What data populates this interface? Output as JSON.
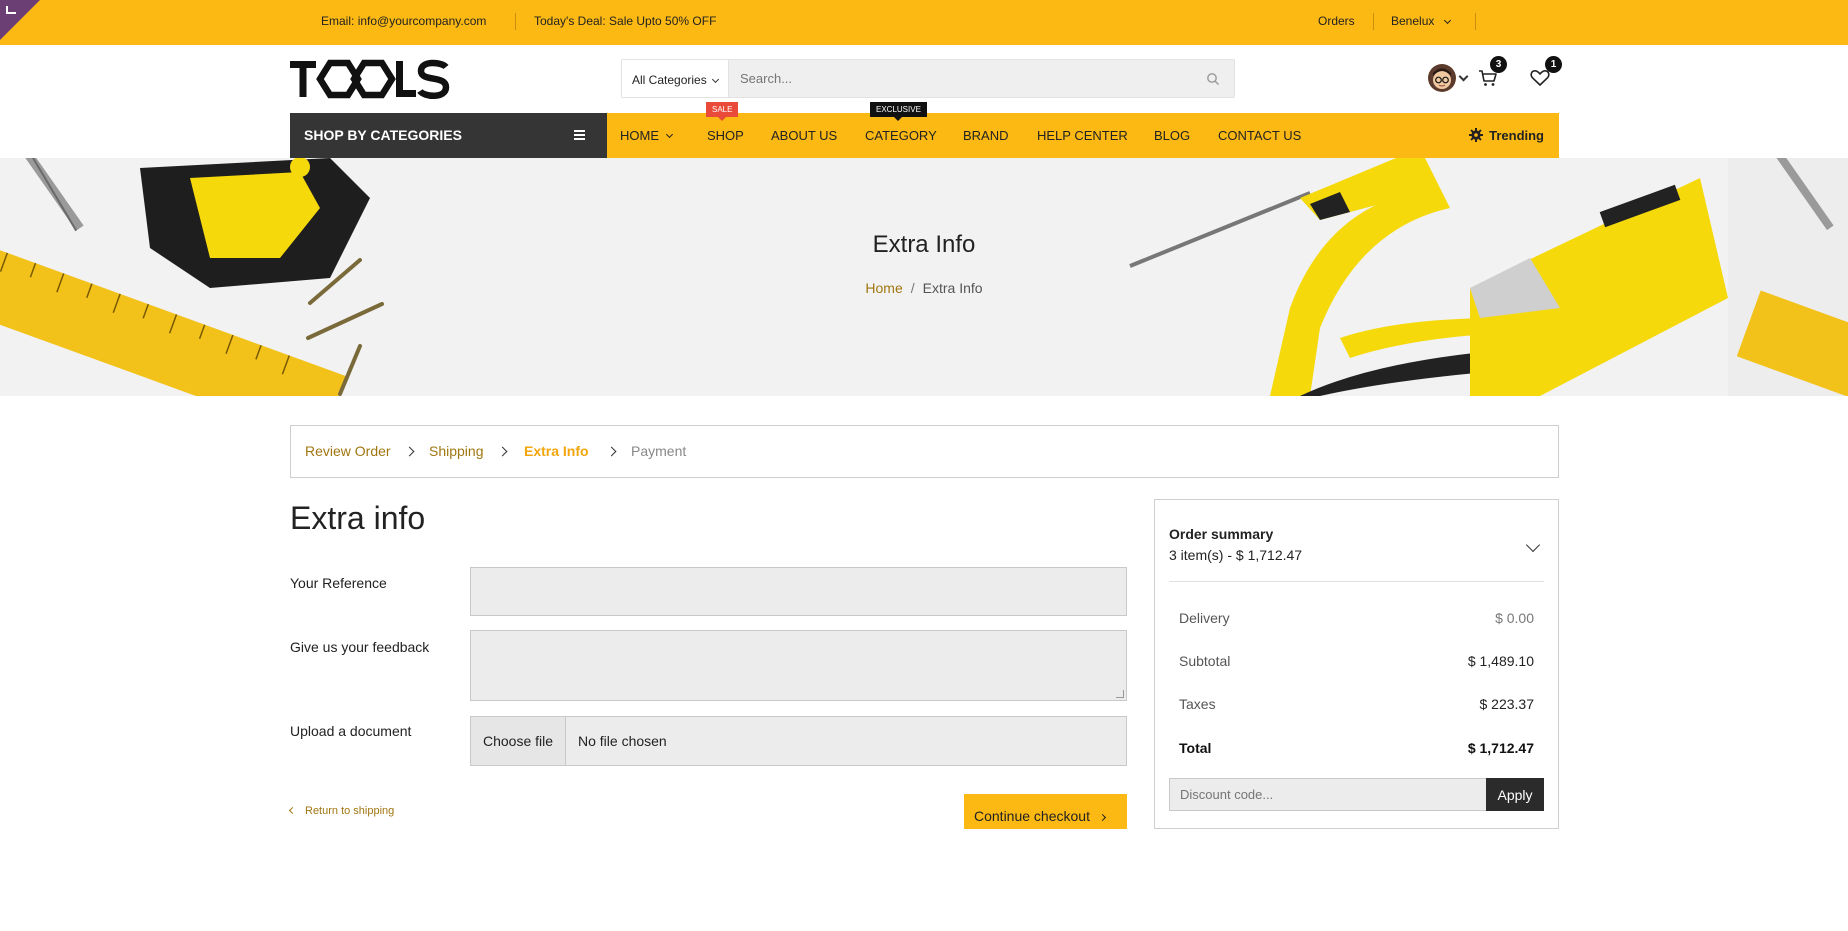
{
  "topbar": {
    "email_label": "Email:",
    "email_value": "info@yourcompany.com",
    "deal_label": "Today's Deal:",
    "deal_value": "Sale Upto 50% OFF",
    "orders": "Orders",
    "region": "Benelux"
  },
  "header": {
    "logo_text": "TOOLS",
    "category_select": "All Categories",
    "search_placeholder": "Search...",
    "cart_count": "3",
    "wishlist_count": "1"
  },
  "nav": {
    "shop_by_categories": "SHOP BY CATEGORIES",
    "items": [
      {
        "label": "HOME"
      },
      {
        "label": "SHOP",
        "tag": "SALE"
      },
      {
        "label": "ABOUT US"
      },
      {
        "label": "CATEGORY",
        "tag": "EXCLUSIVE"
      },
      {
        "label": "BRAND"
      },
      {
        "label": "HELP CENTER"
      },
      {
        "label": "BLOG"
      },
      {
        "label": "CONTACT US"
      }
    ],
    "trending": "Trending"
  },
  "hero": {
    "title": "Extra Info",
    "breadcrumb_home": "Home",
    "breadcrumb_sep": "/",
    "breadcrumb_current": "Extra Info"
  },
  "steps": [
    {
      "label": "Review Order",
      "state": "done"
    },
    {
      "label": "Shipping",
      "state": "done"
    },
    {
      "label": "Extra Info",
      "state": "active"
    },
    {
      "label": "Payment",
      "state": "todo"
    }
  ],
  "form": {
    "title": "Extra info",
    "reference_label": "Your Reference",
    "reference_value": "",
    "feedback_label": "Give us your feedback",
    "feedback_value": "",
    "upload_label": "Upload a document",
    "file_button": "Choose file",
    "file_status": "No file chosen",
    "return_link": "Return to shipping",
    "continue_button": "Continue checkout"
  },
  "summary": {
    "title": "Order summary",
    "items_text": "3 item(s) -  $ 1,712.47",
    "rows": [
      {
        "label": "Delivery",
        "value": "$ 0.00"
      },
      {
        "label": "Subtotal",
        "value": "$ 1,489.10"
      },
      {
        "label": "Taxes",
        "value": "$ 223.37"
      }
    ],
    "total_label": "Total",
    "total_value": "$ 1,712.47",
    "discount_placeholder": "Discount code...",
    "apply_button": "Apply"
  },
  "colors": {
    "accent": "#fdb913",
    "dark": "#353535",
    "link": "#a07610"
  }
}
